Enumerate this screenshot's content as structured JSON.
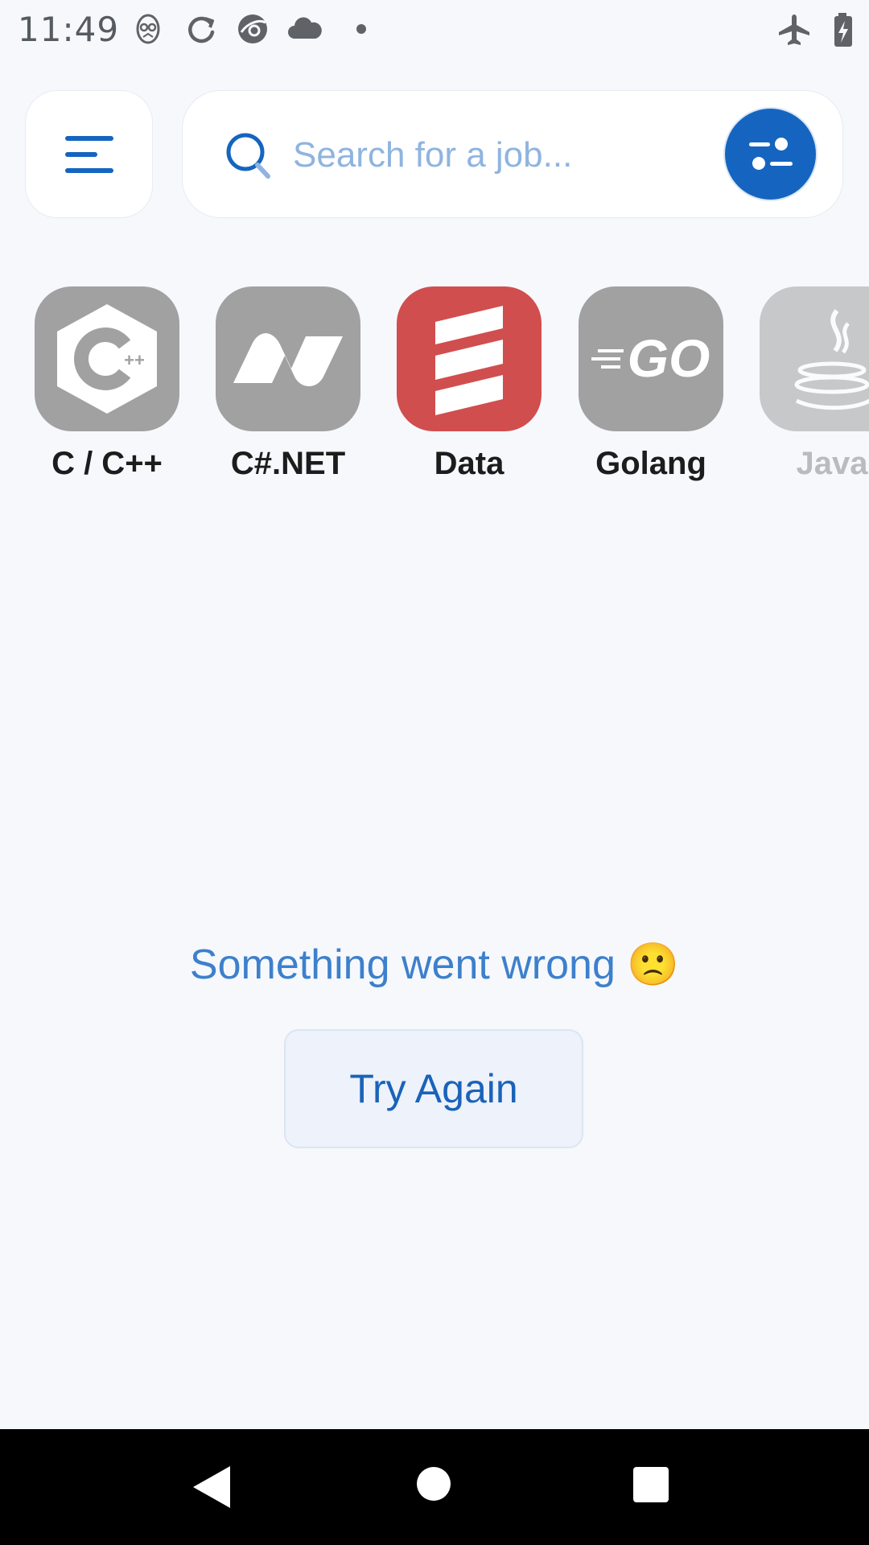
{
  "status_bar": {
    "time": "11:49",
    "icons": [
      "owl-icon",
      "sync-icon",
      "browser-icon",
      "cloud-icon",
      "dot-icon",
      "airplane-mode-icon",
      "battery-charging-icon"
    ]
  },
  "header": {
    "menu_icon": "menu-icon",
    "search": {
      "placeholder": "Search for a job...",
      "value": "",
      "icon": "search-icon"
    },
    "filter_icon": "filter-icon"
  },
  "categories": [
    {
      "label": "C / C++",
      "icon": "cpp-icon",
      "tile_color": "#a1a1a1",
      "selected": false
    },
    {
      "label": "C#.NET",
      "icon": "dotnet-icon",
      "tile_color": "#a1a1a1",
      "selected": false
    },
    {
      "label": "Data",
      "icon": "scala-icon",
      "tile_color": "#d14e4e",
      "selected": true
    },
    {
      "label": "Golang",
      "icon": "go-icon",
      "tile_color": "#a1a1a1",
      "selected": false
    },
    {
      "label": "Java",
      "icon": "java-icon",
      "tile_color": "#a1a1a1",
      "selected": false
    }
  ],
  "error": {
    "message": "Something went wrong 🙁",
    "retry_label": "Try Again"
  },
  "nav_bar": {
    "icons": [
      "back-icon",
      "home-icon",
      "recents-icon"
    ]
  },
  "colors": {
    "accent": "#1565c0",
    "background": "#f6f8fc",
    "error_text": "#3d80cc"
  }
}
